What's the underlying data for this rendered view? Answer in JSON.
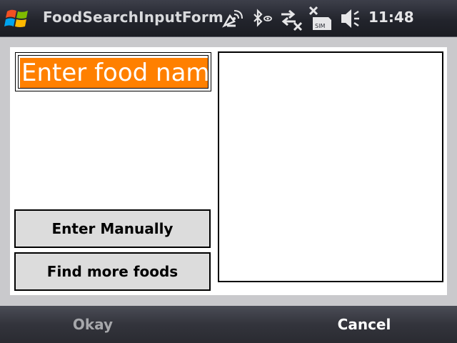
{
  "titlebar": {
    "app_title": "FoodSearchInputForm",
    "clock": "11:48",
    "icons": [
      "windows-start-icon",
      "signal-antenna-icon",
      "bluetooth-icon",
      "data-connection-icon",
      "no-sim-icon",
      "speaker-mute-icon"
    ]
  },
  "form": {
    "search_value": "Enter food nam",
    "enter_manually_label": "Enter Manually",
    "find_more_label": "Find more foods",
    "results_items": []
  },
  "softkeys": {
    "left_label": "Okay",
    "right_label": "Cancel"
  },
  "colors": {
    "selection": "#ff8000",
    "titlebar": "#2a2c34",
    "button_face": "#dcdcdc"
  }
}
